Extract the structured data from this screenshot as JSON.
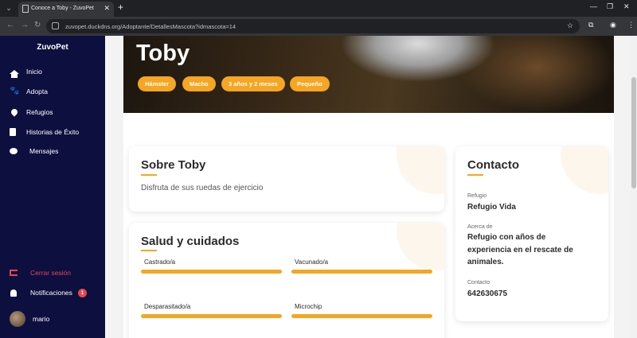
{
  "browser": {
    "tab_title": "Conoce a Toby - ZuvoPet",
    "url": "zuvopet.duckdns.org/Adoptante/DetallesMascota?idmascota=14"
  },
  "sidebar": {
    "brand": "ZuvoPet",
    "items": [
      {
        "label": "Inicio",
        "icon": "home-icon"
      },
      {
        "label": "Adopta",
        "icon": "paw-icon"
      },
      {
        "label": "Refugios",
        "icon": "location-pin-icon"
      },
      {
        "label": "Historias de Éxito",
        "icon": "book-icon"
      },
      {
        "label": "Mensajes",
        "icon": "chat-icon"
      }
    ],
    "logout_label": "Cerrar sesión",
    "notifications_label": "Notificaciones",
    "notifications_count": "1",
    "user_name": "mario"
  },
  "pet": {
    "name": "Toby",
    "tags": [
      "Hámster",
      "Macho",
      "3 años y 2 meses",
      "Pequeño"
    ]
  },
  "about": {
    "title": "Sobre Toby",
    "text": "Disfruta de sus ruedas de ejercicio"
  },
  "health": {
    "title": "Salud y cuidados",
    "items": [
      "Castrado/a",
      "Vacunado/a",
      "Desparasitado/a",
      "Microchip"
    ]
  },
  "contact": {
    "title": "Contacto",
    "refugio_label": "Refugio",
    "refugio_value": "Refugio Vida",
    "acerca_label": "Acerca de",
    "acerca_value_lines": [
      "Refugio con años de",
      "experiencia en el rescate de",
      "animales."
    ],
    "contacto_label": "Contacto",
    "contacto_value": "642630675"
  },
  "colors": {
    "accent": "#f5a623",
    "sidebar_bg": "#0d0f3f",
    "danger": "#e5484d"
  }
}
